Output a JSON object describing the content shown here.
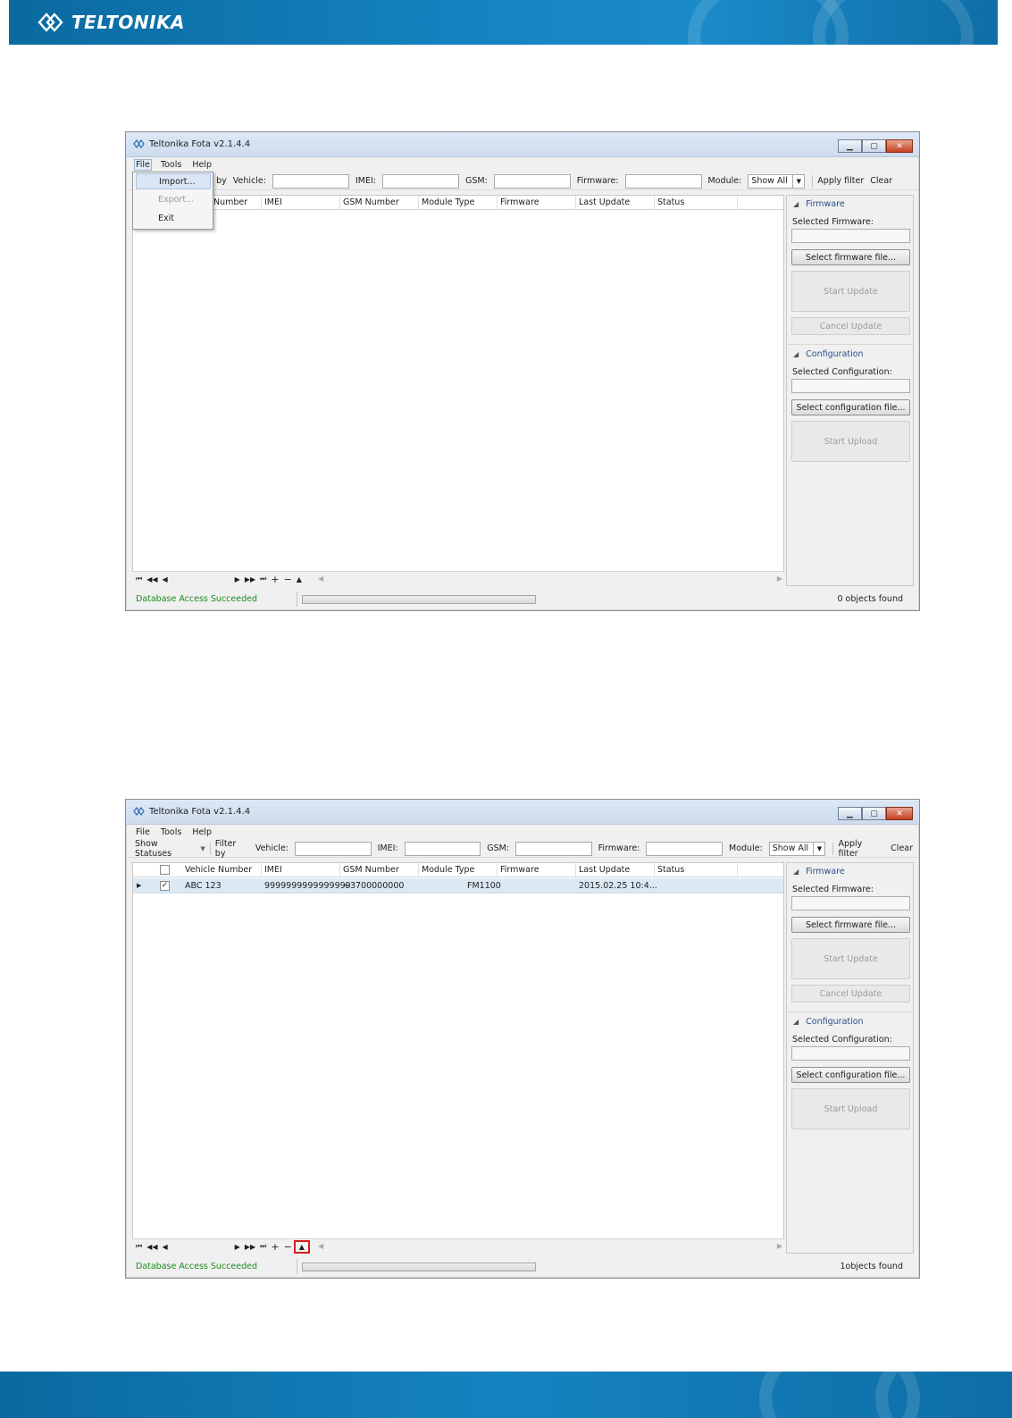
{
  "brand": {
    "name": "TELTONIKA"
  },
  "windows": [
    {
      "title": "Teltonika Fota v2.1.4.4",
      "menu": [
        "File",
        "Tools",
        "Help"
      ],
      "file_menu": {
        "items": [
          "Import...",
          "Export...",
          "Exit"
        ]
      },
      "filter": {
        "show_statuses": "",
        "filter_by": "lter by",
        "vehicle_label": "Vehicle:",
        "imei_label": "IMEI:",
        "gsm_label": "GSM:",
        "firmware_label": "Firmware:",
        "module_label": "Module:",
        "module_value": "Show All",
        "apply": "Apply filter",
        "clear": "Clear"
      },
      "columns": [
        "Number",
        "IMEI",
        "GSM Number",
        "Module Type",
        "Firmware",
        "Last Update",
        "Status"
      ],
      "status": {
        "message": "Database Access Succeeded",
        "count": "0 objects found"
      }
    },
    {
      "title": "Teltonika Fota v2.1.4.4",
      "menu": [
        "File",
        "Tools",
        "Help"
      ],
      "filter": {
        "show_statuses": "Show Statuses",
        "filter_by": "Filter by",
        "vehicle_label": "Vehicle:",
        "imei_label": "IMEI:",
        "gsm_label": "GSM:",
        "firmware_label": "Firmware:",
        "module_label": "Module:",
        "module_value": "Show All",
        "apply": "Apply filter",
        "clear": "Clear"
      },
      "columns": [
        "Vehicle Number",
        "IMEI",
        "GSM Number",
        "Module Type",
        "Firmware",
        "Last Update",
        "Status"
      ],
      "rows": [
        {
          "checked": true,
          "vehicle": "ABC 123",
          "imei": "9999999999999999",
          "gsm": "+3700000000",
          "module": "FM1100",
          "firmware": "",
          "last_update": "2015.02.25 10:4...",
          "status": ""
        }
      ],
      "status": {
        "message": "Database Access Succeeded",
        "count": "1objects found"
      }
    }
  ],
  "side_panel": {
    "firmware_group": "Firmware",
    "selected_firmware_label": "Selected Firmware:",
    "select_firmware_btn": "Select firmware file...",
    "start_update_btn": "Start Update",
    "cancel_update_btn": "Cancel Update",
    "configuration_group": "Configuration",
    "selected_configuration_label": "Selected Configuration:",
    "select_configuration_btn": "Select configuration file...",
    "start_upload_btn": "Start Upload"
  },
  "nav": {
    "first": "⏮",
    "prev_page": "◀◀",
    "prev": "◀",
    "next": "▶",
    "next_page": "▶▶",
    "last": "⏭",
    "add": "+",
    "remove": "−",
    "up": "▲"
  },
  "colors": {
    "banner": "#1482bf",
    "status_ok": "#1c8a1c",
    "highlight": "#d21f1f",
    "selected_row": "#dbe9f5"
  }
}
